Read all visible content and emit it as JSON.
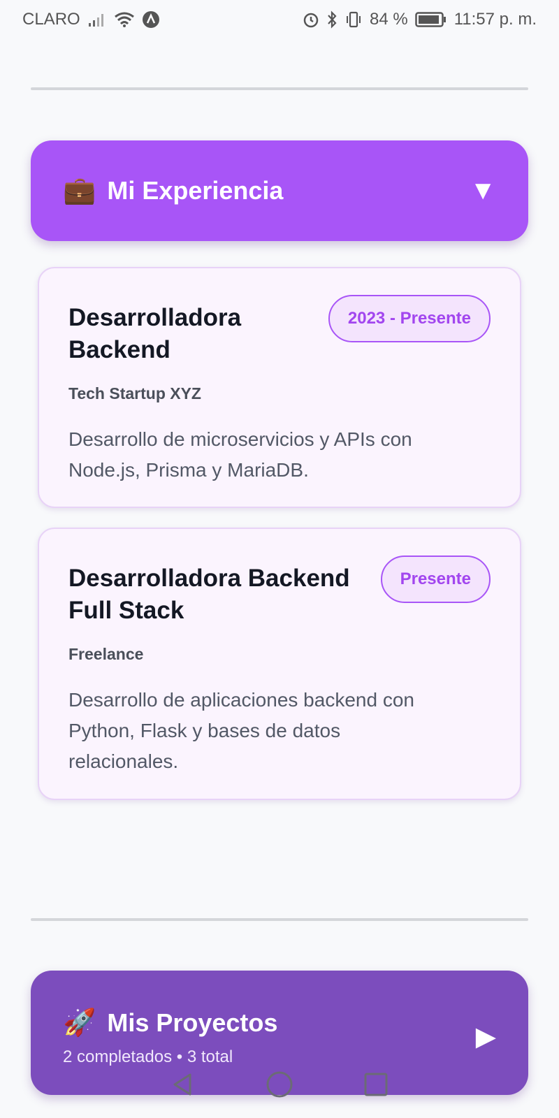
{
  "status_bar": {
    "carrier": "CLARO",
    "battery": "84 %",
    "time": "11:57 p. m.",
    "icons": [
      "signal-icon",
      "wifi-icon",
      "app-notification-icon",
      "alarm-icon",
      "bluetooth-icon",
      "vibrate-icon",
      "battery-icon"
    ]
  },
  "experience": {
    "emoji": "💼",
    "title": "Mi Experiencia",
    "arrow": "▼",
    "items": [
      {
        "title": "Desarrolladora Backend",
        "period": "2023 - Presente",
        "company": "Tech Startup XYZ",
        "description": "Desarrollo de microservicios y APIs con Node.js, Prisma y MariaDB."
      },
      {
        "title": "Desarrolladora Backend Full Stack",
        "period": "Presente",
        "company": "Freelance",
        "description": "Desarrollo de aplicaciones backend con Python, Flask y bases de datos relacionales."
      }
    ]
  },
  "projects": {
    "emoji": "🚀",
    "title": "Mis Proyectos",
    "arrow": "▶",
    "subtitle": "2 completados • 3 total"
  },
  "colors": {
    "experience_header": "#a855f7",
    "projects_header": "#7c4dbd",
    "card_background": "#fbf4fe",
    "badge_text": "#a246ef"
  },
  "nav_bar": {
    "icons": [
      "back-icon",
      "home-icon",
      "recents-icon"
    ]
  }
}
